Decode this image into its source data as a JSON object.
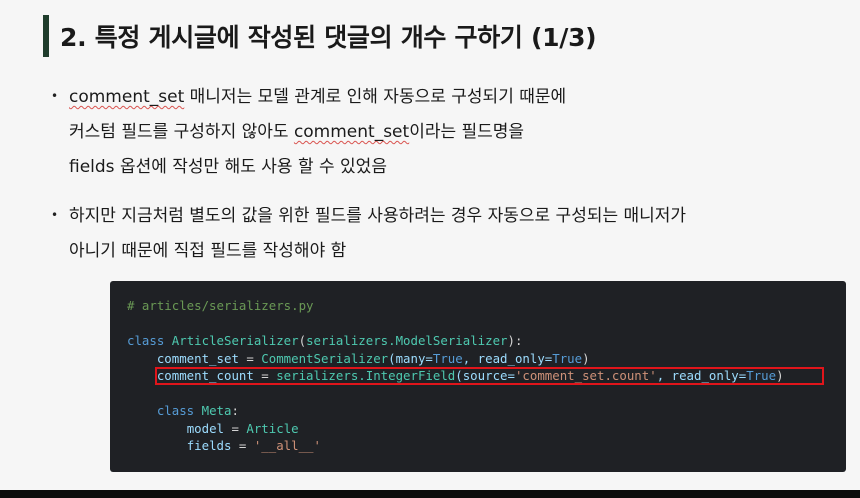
{
  "title": "2. 특정 게시글에 작성된 댓글의 개수 구하기 (1/3)",
  "bullets": [
    {
      "lines": [
        {
          "emph": "comment_set",
          "rest": " 매니저는 모델 관계로 인해 자동으로 구성되기 때문에"
        },
        {
          "pre": "커스텀 필드를 구성하지 않아도 ",
          "emph": "comment_set",
          "rest": "이라는 필드명을"
        },
        {
          "pre": "fields 옵션에 작성만 해도 사용 할 수 있었음"
        }
      ]
    },
    {
      "lines": [
        {
          "pre": "하지만 지금처럼 별도의 값을 위한 필드를 사용하려는 경우 자동으로 구성되는 매니저가"
        },
        {
          "pre": "아니기 때문에 직접 필드를 작성해야 함"
        }
      ]
    }
  ],
  "code": {
    "comment": "# articles/serializers.py",
    "line_class": {
      "kw": "class",
      "name": "ArticleSerializer",
      "paren_open": "(",
      "base": "serializers.ModelSerializer",
      "paren_close": "):"
    },
    "line_comment_set": {
      "indent": "    ",
      "name": "comment_set",
      "eq": " = ",
      "call": "CommentSerializer",
      "args": "(many=",
      "v1": "True",
      "mid": ", read_only=",
      "v2": "True",
      "end": ")"
    },
    "line_comment_count": {
      "indent": "    ",
      "name": "comment_count",
      "eq": " = ",
      "call": "serializers.IntegerField",
      "args": "(source=",
      "v1": "'comment_set.count'",
      "mid": ", read_only=",
      "v2": "True",
      "end": ")"
    },
    "line_meta": {
      "indent": "    ",
      "kw": "class",
      "name": "Meta",
      "end": ":"
    },
    "line_model": {
      "indent": "        ",
      "name": "model",
      "eq": " = ",
      "val": "Article"
    },
    "line_fields": {
      "indent": "        ",
      "name": "fields",
      "eq": " = ",
      "val": "'__all__'"
    }
  },
  "colors": {
    "title_bar": "#1f3d2c",
    "code_bg": "#1f2125",
    "highlight": "#e0151b"
  }
}
